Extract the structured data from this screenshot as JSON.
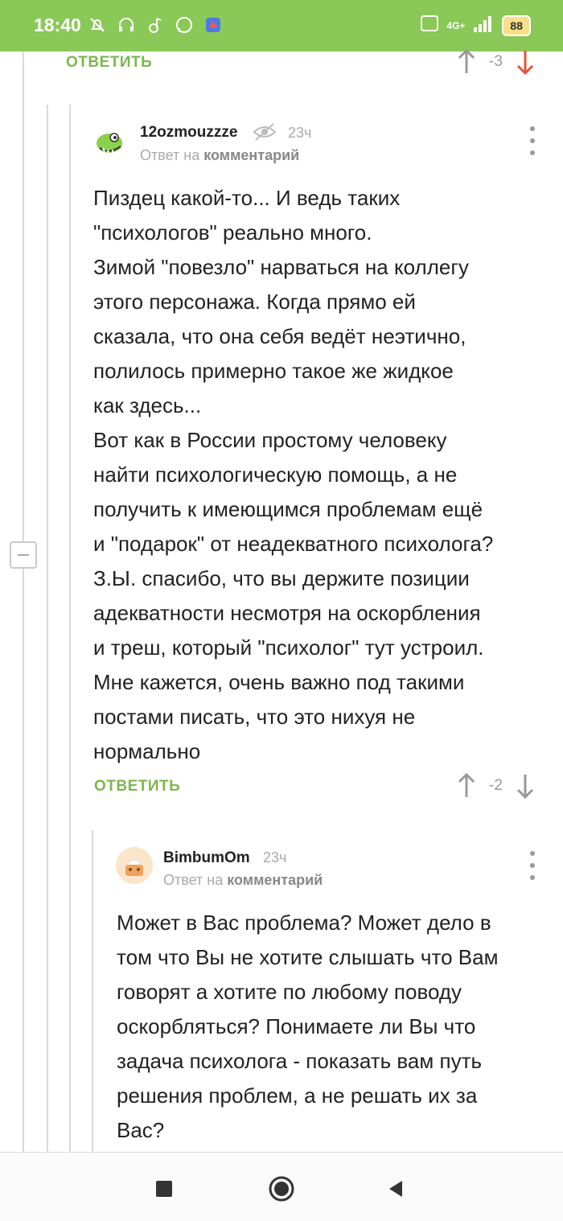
{
  "status_bar": {
    "time": "18:40",
    "icons": [
      "alarm-off-icon",
      "headphones-icon",
      "music-icon",
      "whatsapp-icon",
      "app-icon"
    ],
    "network": "4G+",
    "battery": "88"
  },
  "top_comment": {
    "reply_label": "ОТВЕТИТЬ",
    "score": "-3"
  },
  "comment1": {
    "author": "12ozmouzzze",
    "time": "23ч",
    "reply_to_prefix": "Ответ на",
    "reply_to_link": "комментарий",
    "text": "Пиздец какой-то... И ведь таких\n\"психологов\" реально много.\nЗимой \"повезло\" нарваться на коллегу\nэтого персонажа. Когда прямо ей\nсказала, что она себя ведёт неэтично,\nполилось примерно такое же жидкое\nкак здесь...\nВот как в России простому человеку\nнайти психологическую помощь, а не\nполучить к имеющимся проблемам ещё\nи \"подарок\" от неадекватного психолога?\nЗ.Ы.  спасибо, что вы держите позиции\nадекватности несмотря на оскорбления\nи треш, который \"психолог\" тут устроил.\nМне кажется, очень важно под такими\nпостами писать, что это нихуя не\nнормально",
    "reply_label": "ОТВЕТИТЬ",
    "score": "-2"
  },
  "comment2": {
    "author": "BimbumOm",
    "time": "23ч",
    "reply_to_prefix": "Ответ на",
    "reply_to_link": "комментарий",
    "text": "Может в Вас проблема? Может дело в\nтом что Вы не хотите слышать что Вам\nговорят а хотите по любому поводу\nоскорбляться? Понимаете ли Вы что\nзадача психолога - показать вам путь\nрешения проблем, а не решать их за\nВас?"
  },
  "colors": {
    "accent": "#8ac858",
    "reply": "#7cb74e",
    "downvote_active": "#e2553d"
  }
}
